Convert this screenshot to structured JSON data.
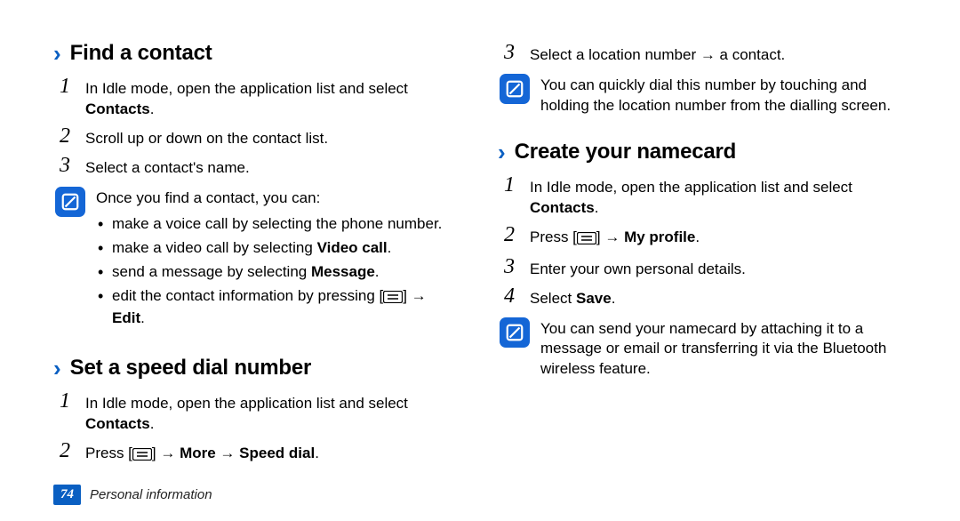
{
  "left": {
    "section1": {
      "heading": "Find a contact",
      "step1_pre": "In Idle mode, open the application list and select ",
      "step1_bold": "Contacts",
      "step1_post": ".",
      "step2": "Scroll up or down on the contact list.",
      "step3": "Select a contact's name.",
      "note_intro": "Once you find a contact, you can:",
      "bullets": {
        "b1": "make a voice call by selecting the phone number.",
        "b2_pre": "make a video call by selecting ",
        "b2_bold": "Video call",
        "b2_post": ".",
        "b3_pre": "send a message by selecting ",
        "b3_bold": "Message",
        "b3_post": ".",
        "b4_pre": "edit the contact information by pressing [",
        "b4_mid": "] → ",
        "b4_bold": "Edit",
        "b4_post": "."
      }
    },
    "section2": {
      "heading": "Set a speed dial number",
      "step1_pre": "In Idle mode, open the application list and select ",
      "step1_bold": "Contacts",
      "step1_post": ".",
      "step2_pre": "Press [",
      "step2_mid": "] → ",
      "step2_bold1": "More",
      "step2_sep": " → ",
      "step2_bold2": "Speed dial",
      "step2_post": "."
    }
  },
  "right": {
    "step3": "Select a location number → a contact.",
    "note1": "You can quickly dial this number by touching and holding the location number from the dialling screen.",
    "section3": {
      "heading": "Create your namecard",
      "step1_pre": "In Idle mode, open the application list and select ",
      "step1_bold": "Contacts",
      "step1_post": ".",
      "step2_pre": "Press [",
      "step2_mid": "] → ",
      "step2_bold": "My profile",
      "step2_post": ".",
      "step3": "Enter your own personal details.",
      "step4_pre": "Select ",
      "step4_bold": "Save",
      "step4_post": "."
    },
    "note2": "You can send your namecard by attaching it to a message or email or transferring it via the Bluetooth wireless feature."
  },
  "footer": {
    "page": "74",
    "section": "Personal information"
  }
}
